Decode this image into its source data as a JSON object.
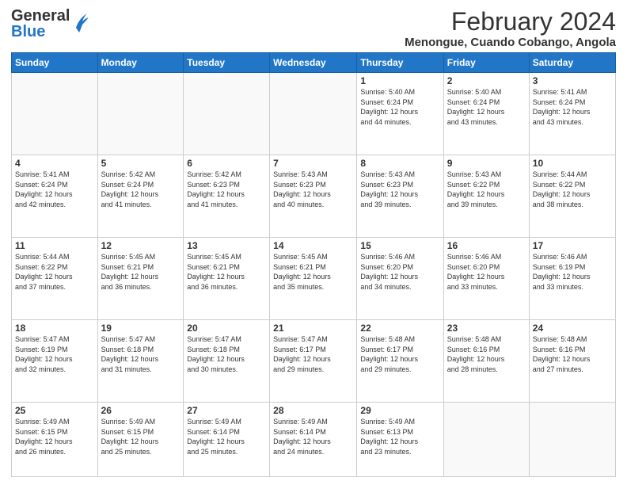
{
  "logo": {
    "line1": "General",
    "line2": "Blue"
  },
  "title": "February 2024",
  "subtitle": "Menongue, Cuando Cobango, Angola",
  "days_of_week": [
    "Sunday",
    "Monday",
    "Tuesday",
    "Wednesday",
    "Thursday",
    "Friday",
    "Saturday"
  ],
  "weeks": [
    [
      {
        "day": "",
        "info": ""
      },
      {
        "day": "",
        "info": ""
      },
      {
        "day": "",
        "info": ""
      },
      {
        "day": "",
        "info": ""
      },
      {
        "day": "1",
        "info": "Sunrise: 5:40 AM\nSunset: 6:24 PM\nDaylight: 12 hours\nand 44 minutes."
      },
      {
        "day": "2",
        "info": "Sunrise: 5:40 AM\nSunset: 6:24 PM\nDaylight: 12 hours\nand 43 minutes."
      },
      {
        "day": "3",
        "info": "Sunrise: 5:41 AM\nSunset: 6:24 PM\nDaylight: 12 hours\nand 43 minutes."
      }
    ],
    [
      {
        "day": "4",
        "info": "Sunrise: 5:41 AM\nSunset: 6:24 PM\nDaylight: 12 hours\nand 42 minutes."
      },
      {
        "day": "5",
        "info": "Sunrise: 5:42 AM\nSunset: 6:24 PM\nDaylight: 12 hours\nand 41 minutes."
      },
      {
        "day": "6",
        "info": "Sunrise: 5:42 AM\nSunset: 6:23 PM\nDaylight: 12 hours\nand 41 minutes."
      },
      {
        "day": "7",
        "info": "Sunrise: 5:43 AM\nSunset: 6:23 PM\nDaylight: 12 hours\nand 40 minutes."
      },
      {
        "day": "8",
        "info": "Sunrise: 5:43 AM\nSunset: 6:23 PM\nDaylight: 12 hours\nand 39 minutes."
      },
      {
        "day": "9",
        "info": "Sunrise: 5:43 AM\nSunset: 6:22 PM\nDaylight: 12 hours\nand 39 minutes."
      },
      {
        "day": "10",
        "info": "Sunrise: 5:44 AM\nSunset: 6:22 PM\nDaylight: 12 hours\nand 38 minutes."
      }
    ],
    [
      {
        "day": "11",
        "info": "Sunrise: 5:44 AM\nSunset: 6:22 PM\nDaylight: 12 hours\nand 37 minutes."
      },
      {
        "day": "12",
        "info": "Sunrise: 5:45 AM\nSunset: 6:21 PM\nDaylight: 12 hours\nand 36 minutes."
      },
      {
        "day": "13",
        "info": "Sunrise: 5:45 AM\nSunset: 6:21 PM\nDaylight: 12 hours\nand 36 minutes."
      },
      {
        "day": "14",
        "info": "Sunrise: 5:45 AM\nSunset: 6:21 PM\nDaylight: 12 hours\nand 35 minutes."
      },
      {
        "day": "15",
        "info": "Sunrise: 5:46 AM\nSunset: 6:20 PM\nDaylight: 12 hours\nand 34 minutes."
      },
      {
        "day": "16",
        "info": "Sunrise: 5:46 AM\nSunset: 6:20 PM\nDaylight: 12 hours\nand 33 minutes."
      },
      {
        "day": "17",
        "info": "Sunrise: 5:46 AM\nSunset: 6:19 PM\nDaylight: 12 hours\nand 33 minutes."
      }
    ],
    [
      {
        "day": "18",
        "info": "Sunrise: 5:47 AM\nSunset: 6:19 PM\nDaylight: 12 hours\nand 32 minutes."
      },
      {
        "day": "19",
        "info": "Sunrise: 5:47 AM\nSunset: 6:18 PM\nDaylight: 12 hours\nand 31 minutes."
      },
      {
        "day": "20",
        "info": "Sunrise: 5:47 AM\nSunset: 6:18 PM\nDaylight: 12 hours\nand 30 minutes."
      },
      {
        "day": "21",
        "info": "Sunrise: 5:47 AM\nSunset: 6:17 PM\nDaylight: 12 hours\nand 29 minutes."
      },
      {
        "day": "22",
        "info": "Sunrise: 5:48 AM\nSunset: 6:17 PM\nDaylight: 12 hours\nand 29 minutes."
      },
      {
        "day": "23",
        "info": "Sunrise: 5:48 AM\nSunset: 6:16 PM\nDaylight: 12 hours\nand 28 minutes."
      },
      {
        "day": "24",
        "info": "Sunrise: 5:48 AM\nSunset: 6:16 PM\nDaylight: 12 hours\nand 27 minutes."
      }
    ],
    [
      {
        "day": "25",
        "info": "Sunrise: 5:49 AM\nSunset: 6:15 PM\nDaylight: 12 hours\nand 26 minutes."
      },
      {
        "day": "26",
        "info": "Sunrise: 5:49 AM\nSunset: 6:15 PM\nDaylight: 12 hours\nand 25 minutes."
      },
      {
        "day": "27",
        "info": "Sunrise: 5:49 AM\nSunset: 6:14 PM\nDaylight: 12 hours\nand 25 minutes."
      },
      {
        "day": "28",
        "info": "Sunrise: 5:49 AM\nSunset: 6:14 PM\nDaylight: 12 hours\nand 24 minutes."
      },
      {
        "day": "29",
        "info": "Sunrise: 5:49 AM\nSunset: 6:13 PM\nDaylight: 12 hours\nand 23 minutes."
      },
      {
        "day": "",
        "info": ""
      },
      {
        "day": "",
        "info": ""
      }
    ]
  ]
}
